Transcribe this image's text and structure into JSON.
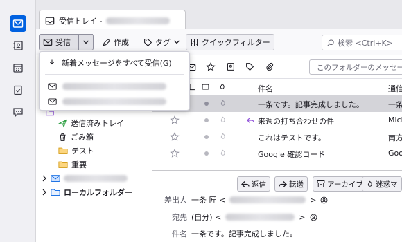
{
  "colors": {
    "accent": "#0061e0",
    "selected_row": "#d4d4d9",
    "sent_green": "#2ea043",
    "folder_yellow": "#f2b01e",
    "reply_purple": "#8f4fd9"
  },
  "tab": {
    "title": "受信トレイ -"
  },
  "toolbar": {
    "get_messages": "受信",
    "write": "作成",
    "tag": "タグ",
    "quick_filter": "クイックフィルター",
    "search_placeholder": "検索 <Ctrl+K>"
  },
  "popup": {
    "get_all": "新着メッセージをすべて受信(G)"
  },
  "folders": [
    {
      "label": "送信済みトレイ",
      "icon": "sent-icon"
    },
    {
      "label": "ごみ箱",
      "icon": "trash-icon"
    },
    {
      "label": "テスト",
      "icon": "folder-icon"
    },
    {
      "label": "重要",
      "icon": "folder-icon"
    }
  ],
  "local_folders": "ローカルフォルダー",
  "quick_filter_placeholder": "このフォルダーのメッセージ",
  "columns": {
    "subject": "件名",
    "correspondent": "通信"
  },
  "messages": [
    {
      "subject": "一条です。記事完成しました。",
      "from": "一条",
      "selected": true,
      "replied": false
    },
    {
      "subject": "来週の打ち合わせの件",
      "from": "Mich",
      "selected": false,
      "replied": true
    },
    {
      "subject": "これはテストです。",
      "from": "南方",
      "selected": false,
      "replied": false
    },
    {
      "subject": "Google 確認コード",
      "from": "Goog",
      "selected": false,
      "replied": false
    }
  ],
  "message_actions": {
    "reply": "返信",
    "forward": "転送",
    "archive": "アーカイブ",
    "junk": "迷惑マ"
  },
  "message_header": {
    "from_label": "差出人",
    "from_name": "一条 匠 <",
    "to_label": "宛先",
    "to_name": "(自分) <",
    "subject_label": "件名",
    "subject": "一条です。記事完成しました。"
  }
}
